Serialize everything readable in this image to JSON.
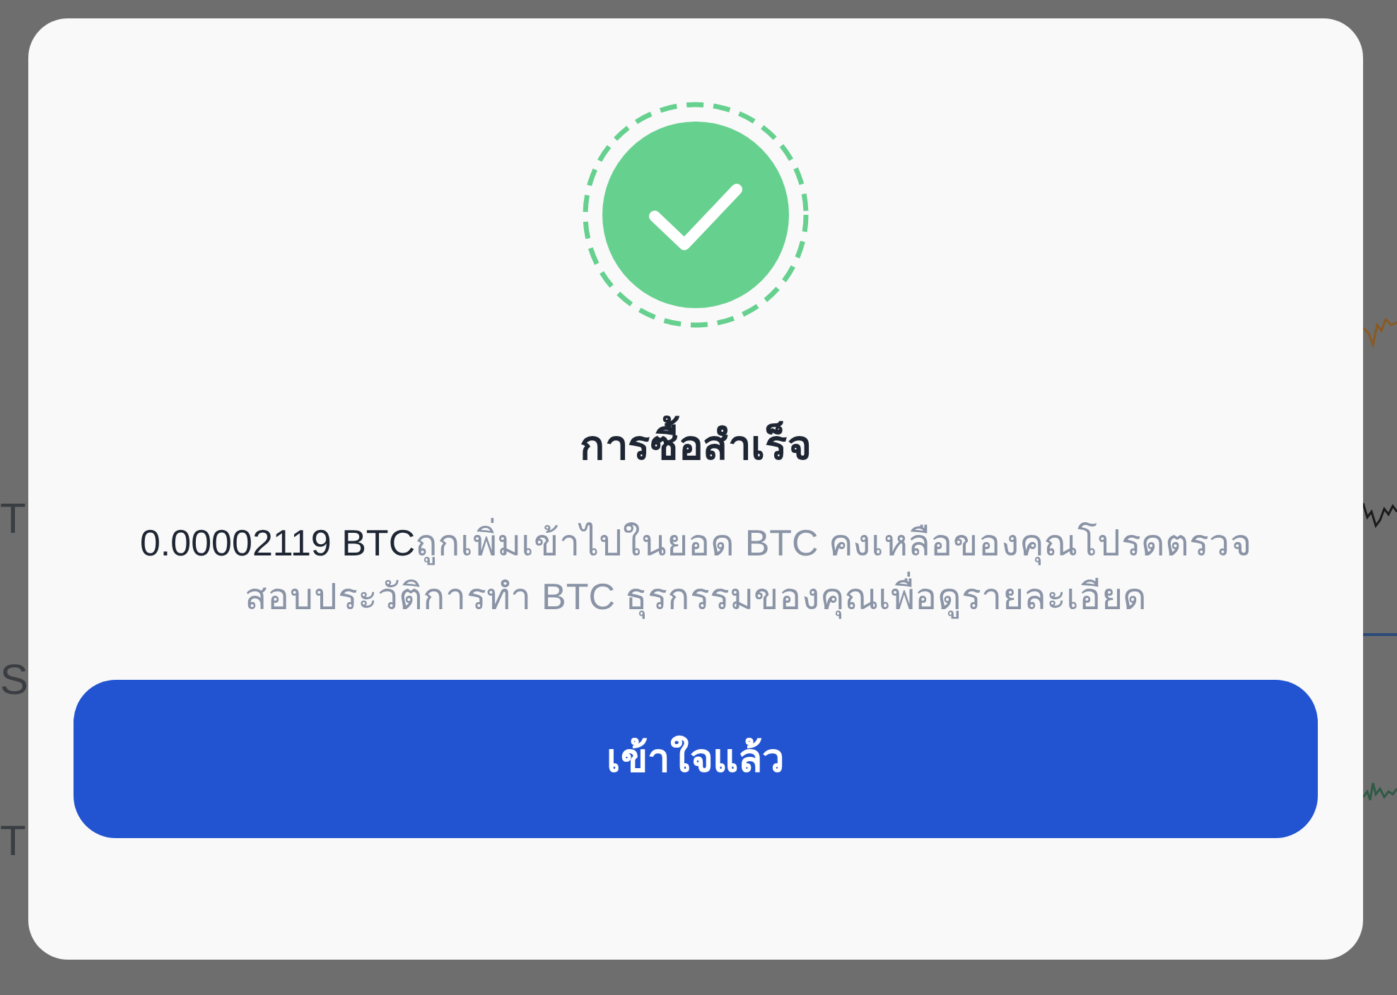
{
  "background": {
    "labels": [
      "T",
      "S",
      "T"
    ]
  },
  "dialog": {
    "title": "การซื้อสำเร็จ",
    "amount": "0.00002119 BTC",
    "message": "ถูกเพิ่มเข้าไปในยอด BTC คงเหลือของคุณโปรดตรวจสอบประวัติการทำ BTC ธุรกรรมของคุณเพื่อดูรายละเอียด",
    "button": "เข้าใจแล้ว"
  }
}
